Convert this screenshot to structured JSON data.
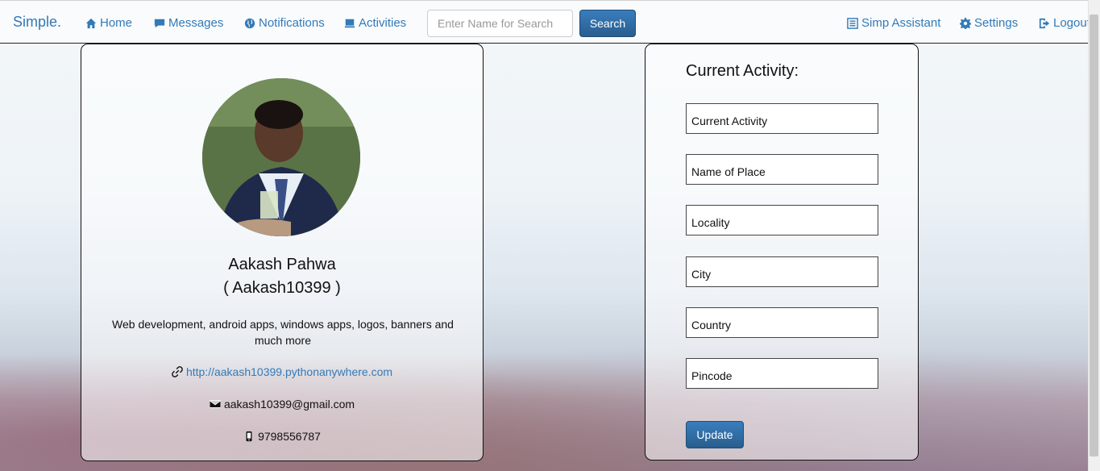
{
  "navbar": {
    "brand": "Simple.",
    "home": "Home",
    "messages": "Messages",
    "notifications": "Notifications",
    "activities": "Activities",
    "search_placeholder": "Enter Name for Search",
    "search_button": "Search",
    "assistant": "Simp Assistant",
    "settings": "Settings",
    "logout": "Logout"
  },
  "profile": {
    "name": "Aakash Pahwa",
    "username": "( Aakash10399 )",
    "bio": "Web development, android apps, windows apps, logos, banners and much more",
    "website": "http://aakash10399.pythonanywhere.com",
    "email": "aakash10399@gmail.com",
    "phone": "9798556787"
  },
  "activity_form": {
    "title": "Current Activity:",
    "fields": {
      "current_activity": "Current Activity",
      "place": "Name of Place",
      "locality": "Locality",
      "city": "City",
      "country": "Country",
      "pincode": "Pincode"
    },
    "update_button": "Update"
  },
  "colors": {
    "link": "#337ab7",
    "primary_button": "#2e6da4"
  },
  "icons": {
    "home": "home-icon",
    "messages": "comment-icon",
    "notifications": "globe-icon",
    "activities": "list-icon",
    "assistant": "list-alt-icon",
    "settings": "gear-icon",
    "logout": "logout-icon",
    "website": "link-icon",
    "email": "envelope-icon",
    "phone": "phone-icon"
  }
}
